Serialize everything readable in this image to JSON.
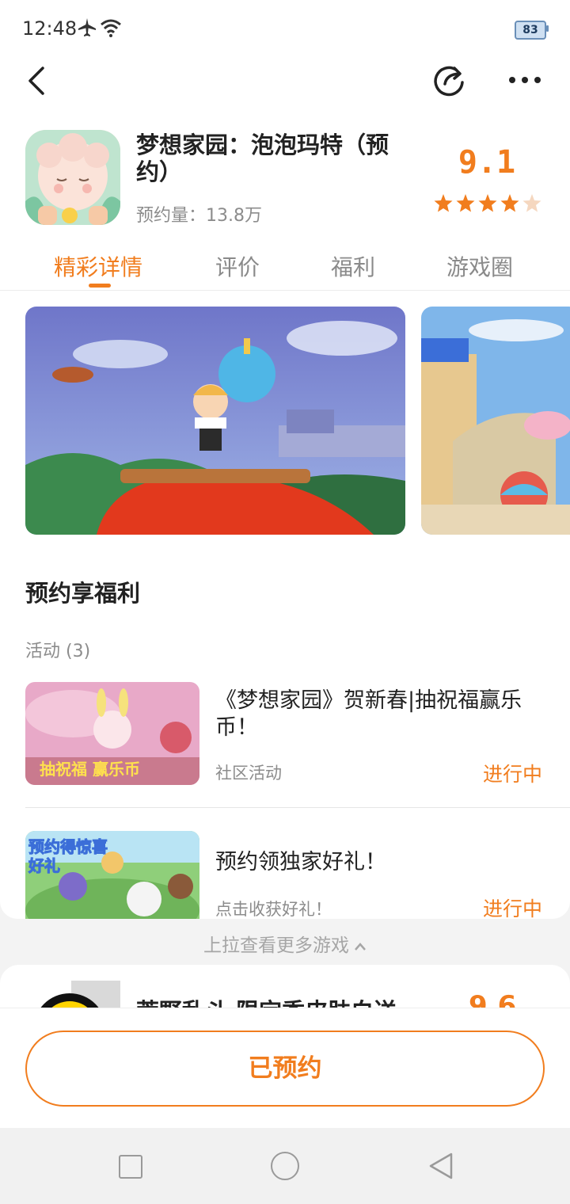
{
  "status_bar": {
    "time": "12:48",
    "battery": "83"
  },
  "app": {
    "title": "梦想家园：泡泡玛特（预约）",
    "reserve_count": "预约量：13.8万",
    "score": "9.1",
    "rating_stars": 4.5
  },
  "tabs": [
    {
      "label": "精彩详情",
      "active": true
    },
    {
      "label": "评价",
      "active": false
    },
    {
      "label": "福利",
      "active": false
    },
    {
      "label": "游戏圈",
      "active": false
    }
  ],
  "benefits": {
    "title": "预约享福利",
    "activity_count": "活动 (3)",
    "activities": [
      {
        "title": "《梦想家园》贺新春|抽祝福赢乐币！",
        "subtitle": "社区活动",
        "status": "进行中",
        "image_text": "抽祝福  赢乐币"
      },
      {
        "title": "预约领独家好礼！",
        "subtitle": "点击收获好礼！",
        "status": "进行中",
        "image_text": "预约得惊喜好礼"
      }
    ]
  },
  "pull_hint": "上拉查看更多游戏",
  "next_game": {
    "title": "荒野乱斗 限定季皮肤白送",
    "score": "9.6"
  },
  "reserved_button": "已预约",
  "colors": {
    "accent": "#f17d1e",
    "star": "#f17d1e"
  }
}
